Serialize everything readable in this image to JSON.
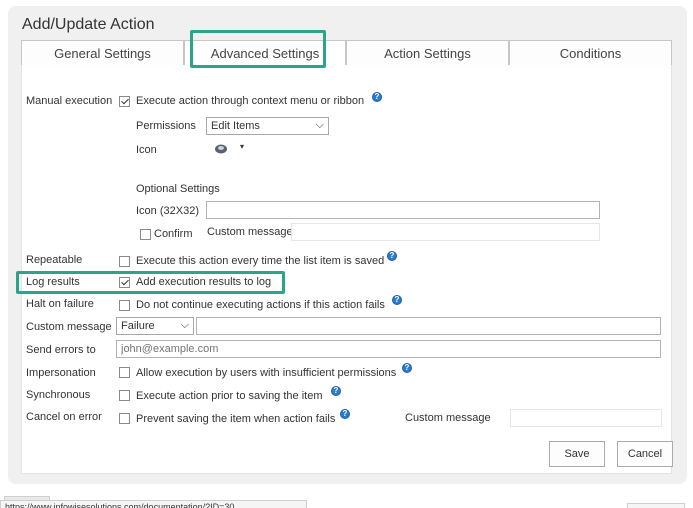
{
  "dialog": {
    "title": "Add/Update Action"
  },
  "tabs": [
    {
      "label": "General Settings"
    },
    {
      "label": "Advanced Settings"
    },
    {
      "label": "Action Settings"
    },
    {
      "label": "Conditions"
    }
  ],
  "manual_execution": {
    "label": "Manual execution",
    "checkbox_label": "Execute action through context menu or ribbon",
    "checked": true,
    "permissions_label": "Permissions",
    "permissions_value": "Edit Items",
    "icon_label": "Icon"
  },
  "optional_settings": {
    "heading": "Optional Settings",
    "icon_label": "Icon (32X32)",
    "confirm_label": "Confirm",
    "custom_message_label": "Custom message"
  },
  "repeatable": {
    "label": "Repeatable",
    "checkbox_label": "Execute this action every time the list item is saved",
    "checked": false
  },
  "log_results": {
    "label": "Log results",
    "checkbox_label": "Add execution results to log",
    "checked": true
  },
  "halt_on_failure": {
    "label": "Halt on failure",
    "checkbox_label": "Do not continue executing actions if this action fails",
    "checked": false
  },
  "custom_message": {
    "label": "Custom message",
    "select_value": "Failure"
  },
  "send_errors": {
    "label": "Send errors to",
    "placeholder": "john@example.com"
  },
  "impersonation": {
    "label": "Impersonation",
    "checkbox_label": "Allow execution by users with insufficient permissions",
    "checked": false
  },
  "synchronous": {
    "label": "Synchronous",
    "checkbox_label": "Execute action prior to saving the item",
    "checked": false
  },
  "cancel_on_error": {
    "label": "Cancel on error",
    "checkbox_label": "Prevent saving the item when action fails",
    "checked": false,
    "custom_message_label": "Custom message"
  },
  "buttons": {
    "save": "Save",
    "cancel": "Cancel"
  },
  "help_glyph": "?",
  "chevron_glyph": "⌵",
  "caret_glyph": "▾",
  "status_bar": {
    "text": "https://www.infowisesolutions.com/documentation/?ID=30"
  },
  "colors": {
    "highlight": "#2aa58a",
    "help_icon": "#2b7bd3"
  }
}
